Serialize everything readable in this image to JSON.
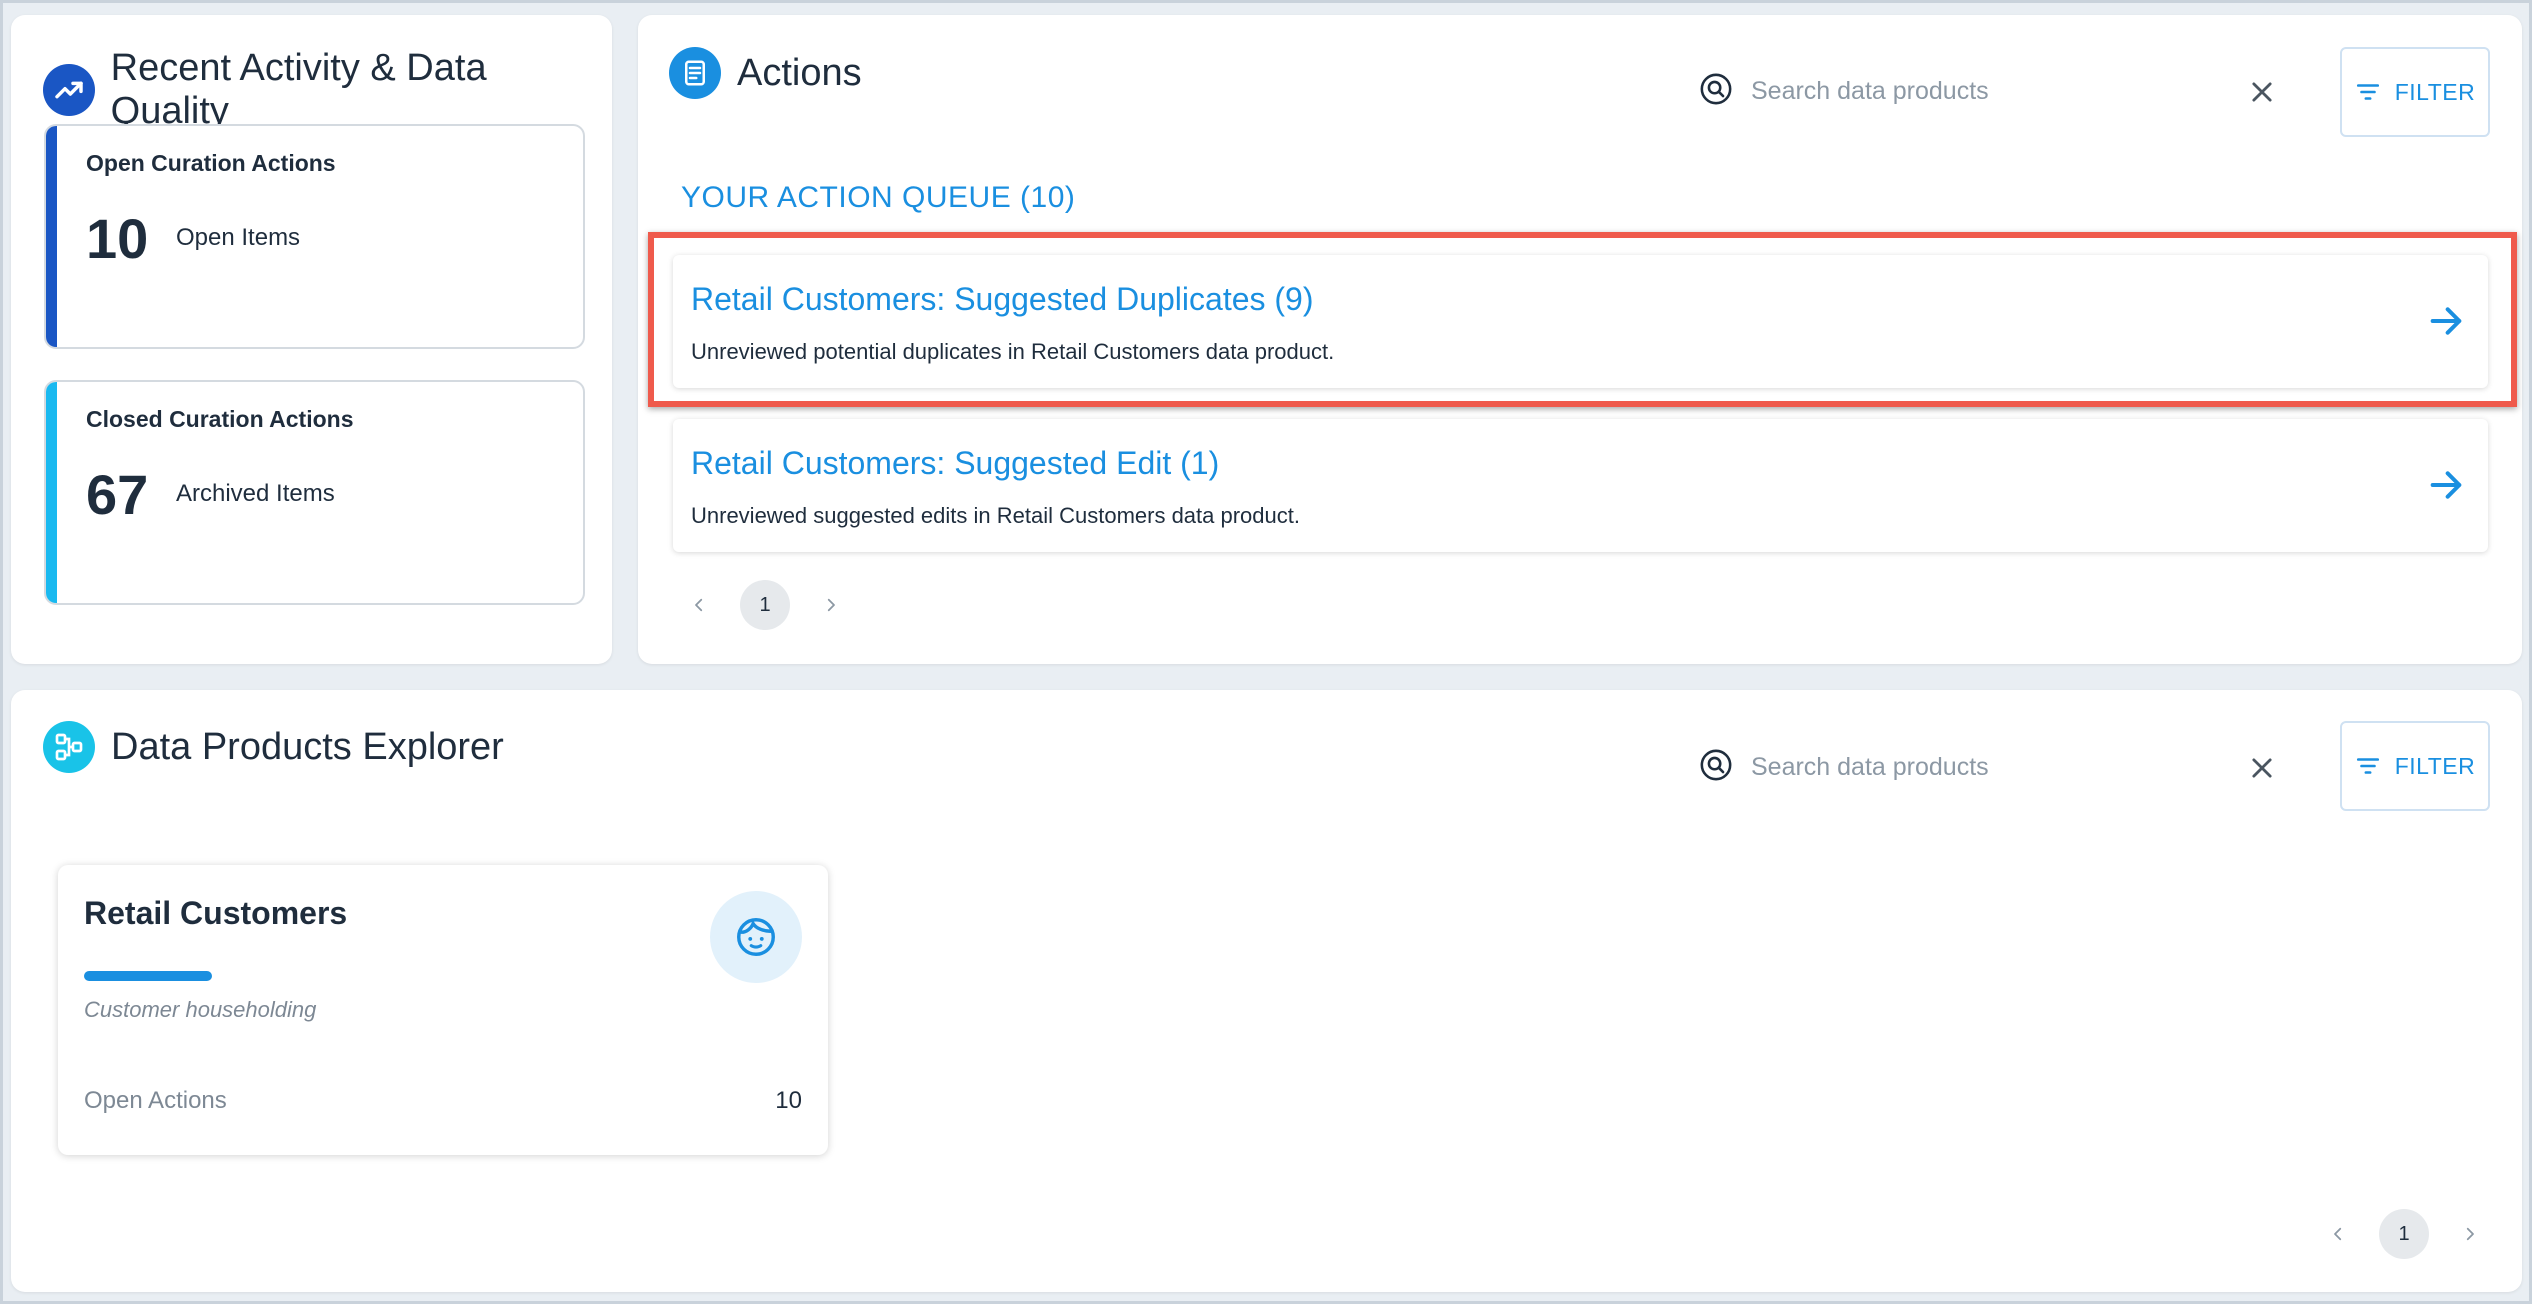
{
  "recent": {
    "title": "Recent Activity & Data Quality",
    "open": {
      "label": "Open Curation Actions",
      "count": "10",
      "unit": "Open Items",
      "color": "#1a56c4"
    },
    "closed": {
      "label": "Closed Curation Actions",
      "count": "67",
      "unit": "Archived Items",
      "color": "#19b9f0"
    }
  },
  "actions": {
    "title": "Actions",
    "search_placeholder": "Search data products",
    "filter_label": "FILTER",
    "queue_label": "YOUR ACTION QUEUE (10)",
    "items": [
      {
        "title": "Retail Customers: Suggested Duplicates (9)",
        "description": "Unreviewed potential duplicates in Retail Customers data product."
      },
      {
        "title": "Retail Customers: Suggested Edit (1)",
        "description": "Unreviewed suggested edits in Retail Customers data product."
      }
    ],
    "page": "1"
  },
  "explorer": {
    "title": "Data Products Explorer",
    "search_placeholder": "Search data products",
    "filter_label": "FILTER",
    "products": [
      {
        "name": "Retail Customers",
        "subtitle": "Customer householding",
        "footer_label": "Open Actions",
        "footer_value": "10"
      }
    ],
    "page": "1"
  },
  "colors": {
    "accent": "#1a8fe0",
    "highlight": "#ef5a4c"
  }
}
